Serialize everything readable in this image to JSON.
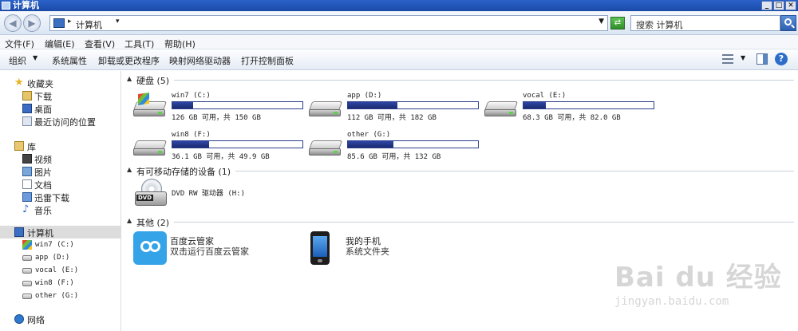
{
  "window": {
    "title": "计算机",
    "buttons": [
      "_",
      "□",
      "✕"
    ]
  },
  "address": {
    "crumb": "计算机",
    "search_placeholder": "搜索 计算机"
  },
  "menu": [
    "文件(F)",
    "编辑(E)",
    "查看(V)",
    "工具(T)",
    "帮助(H)"
  ],
  "commands": [
    "组织",
    "系统属性",
    "卸载或更改程序",
    "映射网络驱动器",
    "打开控制面板"
  ],
  "nav": {
    "favorites": {
      "label": "收藏夹",
      "items": [
        "下载",
        "桌面",
        "最近访问的位置"
      ]
    },
    "libraries": {
      "label": "库",
      "items": [
        "视频",
        "图片",
        "文档",
        "迅雷下载",
        "音乐"
      ]
    },
    "computer": {
      "label": "计算机",
      "items": [
        "win7 (C:)",
        "app (D:)",
        "vocal (E:)",
        "win8 (F:)",
        "other (G:)"
      ]
    },
    "network": {
      "label": "网络"
    }
  },
  "groups": {
    "hdd": "硬盘 (5)",
    "removable": "有可移动存储的设备 (1)",
    "other": "其他 (2)"
  },
  "drives": [
    {
      "name": "win7 (C:)",
      "size": "126 GB 可用，共 150 GB",
      "used_fraction": 0.16
    },
    {
      "name": "app (D:)",
      "size": "112 GB 可用，共 182 GB",
      "used_fraction": 0.38
    },
    {
      "name": "vocal (E:)",
      "size": "68.3 GB 可用，共 82.0 GB",
      "used_fraction": 0.17
    },
    {
      "name": "win8 (F:)",
      "size": "36.1 GB 可用，共 49.9 GB",
      "used_fraction": 0.28
    },
    {
      "name": "other (G:)",
      "size": "85.6 GB 可用，共 132 GB",
      "used_fraction": 0.35
    }
  ],
  "dvd": {
    "name": "DVD RW 驱动器 (H:)",
    "badge": "DVD"
  },
  "others": [
    {
      "name": "百度云管家",
      "desc": "双击运行百度云管家"
    },
    {
      "name": "我的手机",
      "desc": "系统文件夹"
    }
  ],
  "watermark": {
    "logo": "Bai du 经验",
    "url": "jingyan.baidu.com"
  }
}
